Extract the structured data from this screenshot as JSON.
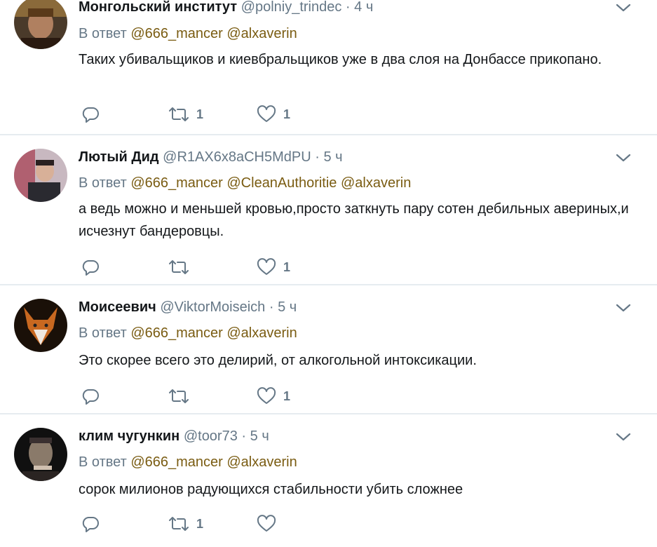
{
  "tweets": [
    {
      "name": "Монгольский институт",
      "handle": "@polniy_trindec",
      "dot": "·",
      "time": "4 ч",
      "reply_prefix": "В ответ",
      "mentions": [
        "@666_mancer",
        "@alxaverin"
      ],
      "text": "Таких убивальщиков и киевбральщиков уже в два слоя на Донбассе прикопано.",
      "retweet_count": "1",
      "like_count": "1"
    },
    {
      "name": "Лютый Дид",
      "handle": "@R1AX6x8aCH5MdPU",
      "dot": "·",
      "time": "5 ч",
      "reply_prefix": "В ответ",
      "mentions": [
        "@666_mancer",
        "@CleanAuthoritie",
        "@alxaverin"
      ],
      "text": "а ведь можно и меньшей кровью,просто заткнуть пару сотен дебильных авериных,и исчезнут бандеровцы.",
      "retweet_count": "",
      "like_count": "1"
    },
    {
      "name": "Моисеевич",
      "handle": "@ViktorMoiseich",
      "dot": "·",
      "time": "5 ч",
      "reply_prefix": "В ответ",
      "mentions": [
        "@666_mancer",
        "@alxaverin"
      ],
      "text": "Это скорее всего это делирий, от алкогольной интоксикации.",
      "retweet_count": "",
      "like_count": "1"
    },
    {
      "name": "клим чугункин",
      "handle": "@toor73",
      "dot": "·",
      "time": "5 ч",
      "reply_prefix": "В ответ",
      "mentions": [
        "@666_mancer",
        "@alxaverin"
      ],
      "text": "сорок милионов радующихся стабильности убить сложнее",
      "retweet_count": "1",
      "like_count": ""
    }
  ],
  "colors": {
    "text": "#14171a",
    "secondary": "#657786",
    "mention": "#7a5c12",
    "separator": "#e6ecf0"
  },
  "icons": [
    "reply-icon",
    "retweet-icon",
    "like-icon",
    "chevron-down-icon",
    "avatar"
  ]
}
